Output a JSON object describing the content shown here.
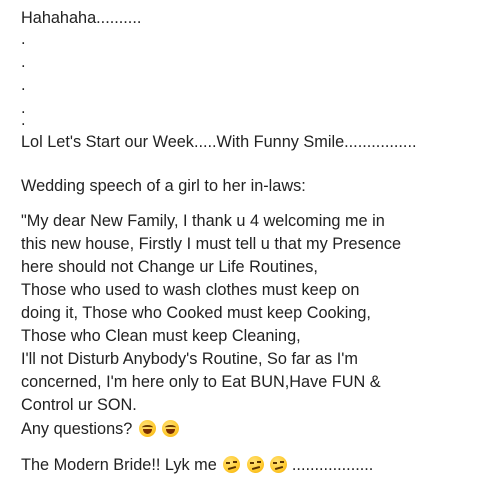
{
  "lines": {
    "l1": "Hahahaha..........",
    "dot1": ".",
    "dot2": ".",
    "dot3": ".",
    "dot4": ".",
    "dot5": ".",
    "l2": "Lol Let's Start our Week.....With Funny Smile................",
    "l3": "Wedding speech of a girl to her in-laws:",
    "p1": "\"My dear New Family, I thank u 4 welcoming me in",
    "p2": "this new house, Firstly I must tell u that my Presence",
    "p3": "here should not Change ur Life Routines,",
    "p4": "Those who used to wash clothes must keep on",
    "p5": "doing it, Those who Cooked must keep Cooking,",
    "p6": "Those who Clean must keep Cleaning,",
    "p7": "I'll not Disturb Anybody's Routine, So far as I'm",
    "p8": "concerned, I'm here only to Eat BUN,Have FUN &",
    "p9": "Control ur SON.",
    "q": "Any questions?",
    "last": "The Modern Bride!! Lyk me",
    "last_tail": ".................."
  },
  "icons": {
    "laugh": "face-with-tears-of-joy-icon",
    "smirk": "smirking-face-icon"
  }
}
